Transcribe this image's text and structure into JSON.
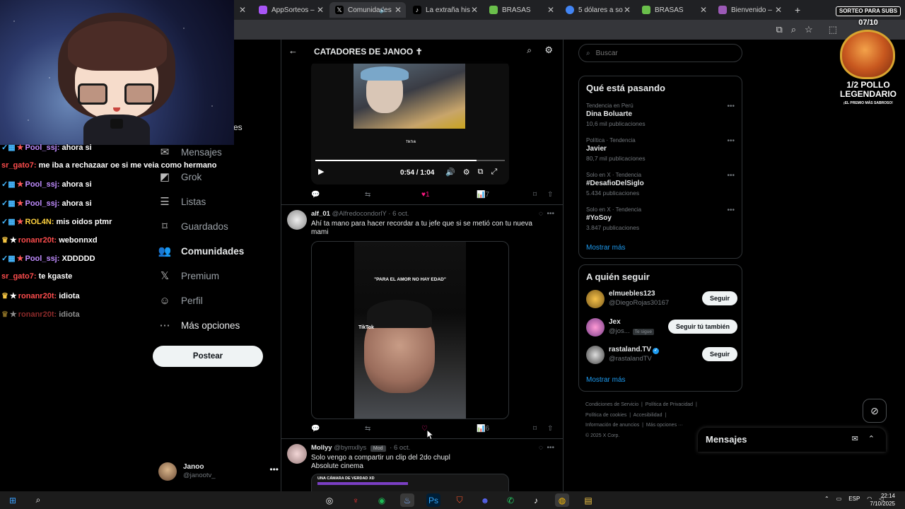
{
  "browser": {
    "tabs": [
      {
        "title": "AppSorteos –",
        "color": "#a855f7"
      },
      {
        "title": "Comunidades",
        "color": "#ffffff"
      },
      {
        "title": "La extraña his",
        "color": "#ffffff"
      },
      {
        "title": "BRASAS",
        "color": "#6abf4b"
      },
      {
        "title": "5 dólares a so",
        "color": "#4285f4"
      },
      {
        "title": "BRASAS",
        "color": "#6abf4b"
      },
      {
        "title": "Bienvenido – ",
        "color": "#9b59b6"
      }
    ]
  },
  "nav": {
    "items": [
      {
        "label": "Mensajes",
        "icon": "mail-icon"
      },
      {
        "label": "Grok",
        "icon": "grok-icon"
      },
      {
        "label": "Listas",
        "icon": "list-icon"
      },
      {
        "label": "Guardados",
        "icon": "bookmark-icon"
      },
      {
        "label": "Comunidades",
        "icon": "communities-icon"
      },
      {
        "label": "Premium",
        "icon": "x-logo-icon"
      },
      {
        "label": "Perfil",
        "icon": "profile-icon"
      },
      {
        "label": "Más opciones",
        "icon": "more-circle-icon"
      }
    ],
    "hidden_fragment": "es",
    "post_button": "Postear",
    "account": {
      "name": "Janoo",
      "handle": "@janootv_"
    }
  },
  "timeline": {
    "title": "CATADORES DE JANOO ✝",
    "video1": {
      "time": "0:54 / 1:04",
      "progress": 0.85,
      "watermark": "TikTok"
    },
    "post1_actions": {
      "likes": "1",
      "views": "7"
    },
    "post2": {
      "name": "alf_01",
      "handle": "@AlfredocondorlY",
      "date": "6 oct.",
      "text": "Ahí ta mano para hacer recordar a tu jefe que si se metió con tu nueva mami",
      "caption": "\"PARA EL AMOR NO HAY EDAD\"",
      "watermark": "TikTok",
      "actions": {
        "views": "6"
      }
    },
    "post3": {
      "name": "Mollyy",
      "handle": "@bymxllys",
      "badge": "Mod",
      "date": "6 oct.",
      "text": "Solo vengo a compartir un clip del 2do chupl",
      "text2": "Absolute cinema",
      "clip_label": "UNA CÁMARA DE VERDAD XD"
    }
  },
  "right": {
    "search_placeholder": "Buscar",
    "trends_title": "Qué está pasando",
    "trends": [
      {
        "context": "Tendencia en Perú",
        "title": "Dina Boluarte",
        "count": "10,6 mil publicaciones"
      },
      {
        "context": "Política · Tendencia",
        "title": "Javier",
        "count": "80,7 mil publicaciones"
      },
      {
        "context": "Solo en X · Tendencia",
        "title": "#DesafioDelSiglo",
        "count": "5.434 publicaciones"
      },
      {
        "context": "Solo en X · Tendencia",
        "title": "#YoSoy",
        "count": "3.847 publicaciones"
      }
    ],
    "show_more": "Mostrar más",
    "follow_title": "A quién seguir",
    "follow": [
      {
        "name": "elmuebles123",
        "handle": "@DiegoRojas30167",
        "button": "Seguir",
        "tag": ""
      },
      {
        "name": "Jex",
        "handle": "@jos...",
        "button": "Seguir tú también",
        "tag": "Te sigue"
      },
      {
        "name": "rastaland.TV",
        "handle": "@rastalandTV",
        "button": "Seguir",
        "tag": ""
      }
    ],
    "follow_show_more": "Mostrar más",
    "footer": [
      "Condiciones de Servicio",
      "|",
      "Política de Privacidad",
      "|",
      "Política de cookies",
      "|",
      "Accesibilidad",
      "|",
      "Información de anuncios",
      "|",
      "Más opciones ···",
      "© 2025 X Corp."
    ],
    "messages": "Mensajes"
  },
  "overlay": {
    "chat": [
      {
        "user": "Pool_ssj",
        "msg": "ahora si",
        "color": "#c08cff",
        "style": "badges"
      },
      {
        "user": "sr_gato7",
        "msg": "me iba a rechazaar oe si me veia como hermano",
        "color": "#ff4d4d",
        "style": "plain"
      },
      {
        "user": "Pool_ssj",
        "msg": "ahora si",
        "color": "#c08cff",
        "style": "badges"
      },
      {
        "user": "Pool_ssj",
        "msg": "ahora si",
        "color": "#c08cff",
        "style": "badges"
      },
      {
        "user": "ROL4N",
        "msg": "mis oidos ptmr",
        "color": "#ffd23f",
        "style": "badges"
      },
      {
        "user": "ronanr20t",
        "msg": "webonnxd",
        "color": "#ff4d4d",
        "style": "crown"
      },
      {
        "user": "Pool_ssj",
        "msg": "XDDDDD",
        "color": "#c08cff",
        "style": "badges"
      },
      {
        "user": "sr_gato7",
        "msg": "te kgaste",
        "color": "#ff4d4d",
        "style": "plain"
      },
      {
        "user": "ronanr20t",
        "msg": "idiota",
        "color": "#ff4d4d",
        "style": "crown"
      },
      {
        "user": "ronanr20t",
        "msg": "idiota",
        "color": "#ff4d4d",
        "style": "crown-dim"
      }
    ],
    "promo": {
      "header": "SORTEO PARA SUBS",
      "count": "07/10",
      "title": "1/2 POLLO LEGENDARIO",
      "subtitle": "¡EL PREMIO MÁS SABROSO!"
    }
  },
  "taskbar": {
    "lang": "ESP",
    "time": "22:14",
    "date": "7/10/2025"
  }
}
